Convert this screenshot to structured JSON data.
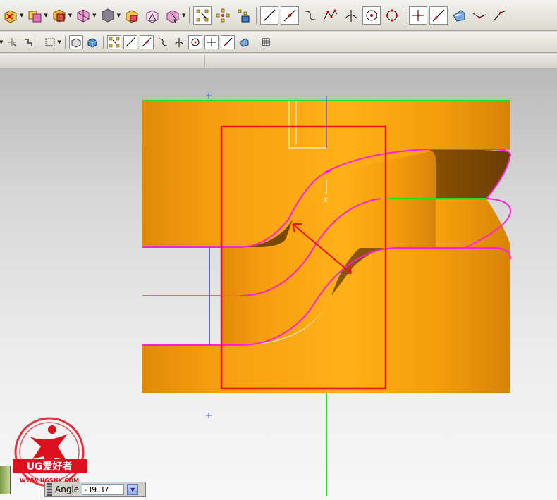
{
  "dialog": {
    "angle_label": "Angle",
    "angle_value": "-39.37"
  },
  "watermark": {
    "brand": "UG爱好者",
    "url": "WWW.UGSNX.COM"
  },
  "viewport": {
    "triad_label": "X",
    "colors": {
      "part_orange": "#f7a10d",
      "edge_magenta": "#ff1fd8",
      "datum_green": "#22dd22",
      "highlight_red": "#e8101a",
      "datum_blue": "#2b3bff"
    }
  },
  "toolbar": {
    "row1_icons": [
      "cube-copy-icon",
      "cube-layers-icon",
      "cube-stack-icon",
      "cube-frame-icon",
      "sphere-icon",
      "cube-move-icon",
      "cube-triangle-icon",
      "cube-select-icon",
      "snap-endpoint-icon",
      "snap-grid-icon",
      "snap-point-icon",
      "line-icon",
      "line-point-icon",
      "curve-icon",
      "spline-icon",
      "intersection-icon",
      "circle-center-icon",
      "circle-quadrant-icon",
      "cross-icon",
      "diagonal-icon",
      "view-icon",
      "angle-icon",
      "slope-icon"
    ],
    "row2_icons": [
      "snap-point-icon",
      "snap-intersection-icon",
      "filter-icon",
      "select-box-icon",
      "view-shaded-icon",
      "view-cube-icon",
      "snap-endpoint-icon",
      "line-icon",
      "line-point-icon",
      "curve-icon",
      "intersection-icon",
      "circle-center-icon",
      "cross-icon",
      "diagonal-icon",
      "view-icon",
      "grid-icon"
    ]
  }
}
